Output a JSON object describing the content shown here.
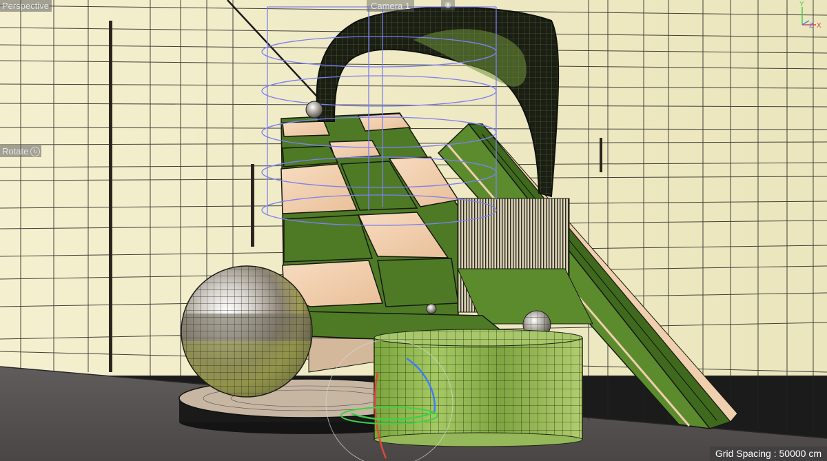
{
  "viewport": {
    "view_label": "Perspective",
    "camera_label": "Camera 1",
    "camera_icon": "camera-icon",
    "mode_label": "Rotate",
    "mode_icon": "rotate-icon"
  },
  "status": {
    "grid_spacing": "Grid Spacing : 50000 cm"
  },
  "axes": {
    "x_label": "X",
    "y_label": "Y",
    "z_label": "Z",
    "x_color": "#e0463e",
    "y_color": "#3fcf4a",
    "z_color": "#3d7cff"
  },
  "colors": {
    "wall": "#f1ecc7",
    "floor": "#575353",
    "green": "#4e7a26",
    "peach": "#f0cfae",
    "selection": "#7c80f2"
  }
}
